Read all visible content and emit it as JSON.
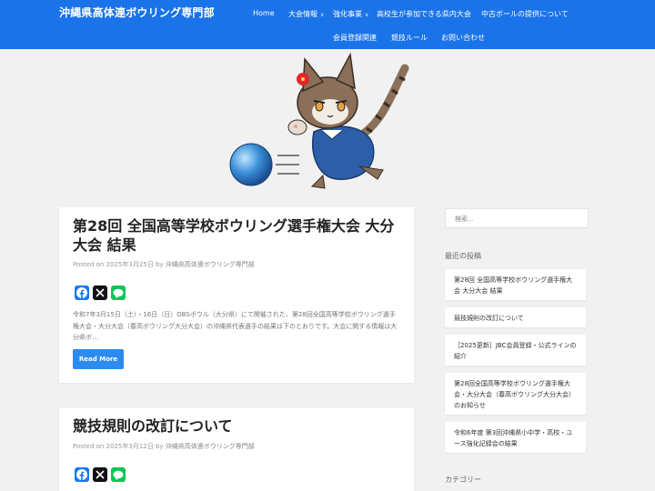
{
  "site": {
    "title": "沖縄県高体連ボウリング専門部"
  },
  "nav": {
    "home": "Home",
    "events": "大会情報",
    "training": "強化事業",
    "prefectural": "高校生が参加できる県内大会",
    "used_balls": "中古ボールの提供について",
    "registration": "会員登録関連",
    "rules": "競技ルール",
    "contact": "お問い合わせ"
  },
  "posts": [
    {
      "title": "第28回 全国高等学校ボウリング選手権大会 大分大会 結果",
      "meta_posted": "Posted on 2025年3月25日 by ",
      "meta_author": "沖縄県高体連ボウリング専門部",
      "excerpt": "令和7年3月15日（土）・16日（日）OBSボウル（大分県）にて開催された、第28回全国高等学校ボウリング選手権大会・大分大会（春高ボウリング大分大会）の沖縄県代表選手の結果は下のとおりです。大会に関する情報は大分県ボ…",
      "read_more": "Read More"
    },
    {
      "title": "競技規則の改訂について",
      "meta_posted": "Posted on 2025年3月12日 by ",
      "meta_author": "沖縄県高体連ボウリング専門部"
    }
  ],
  "sidebar": {
    "search_placeholder": "検索...",
    "recent_title": "最近の投稿",
    "recent_posts": [
      "第28回 全国高等学校ボウリング選手権大会 大分大会 結果",
      "競技規則の改訂について",
      "［2025更新］JBC会員登録・公式ラインの紹介",
      "第28回全国高等学校ボウリング選手権大会・大分大会（春高ボウリング大分大会）のお知らせ",
      "令和6年度 第3回沖縄県小中学・高校・ユース強化記録会の結果"
    ],
    "category_title": "カテゴリー"
  },
  "share_icons": [
    "facebook-icon",
    "x-icon",
    "line-icon"
  ],
  "colors": {
    "header": "#1a73e8",
    "button": "#2d8bf0",
    "facebook": "#1877f2",
    "x": "#111111",
    "line": "#06c755"
  }
}
